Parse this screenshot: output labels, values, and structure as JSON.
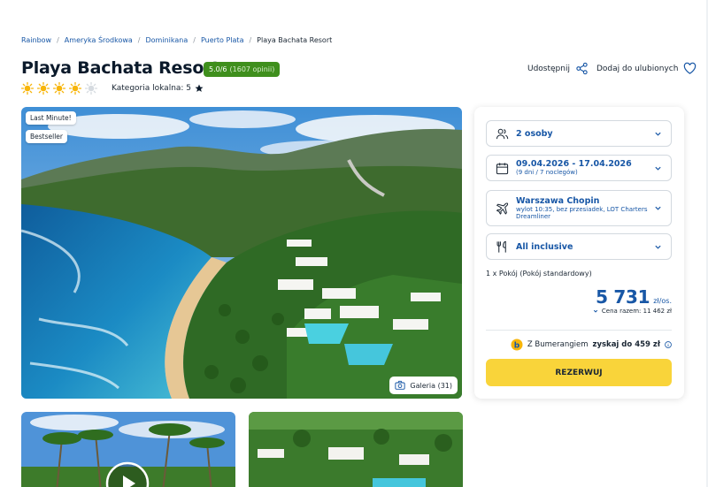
{
  "breadcrumb": [
    "Rainbow",
    "Ameryka Środkowa",
    "Dominikana",
    "Puerto Plata",
    "Playa Bachata Resort"
  ],
  "hotel": {
    "name": "Playa Bachata Resort",
    "rating": "5.0/6",
    "reviews": "(1607 opinii)",
    "stars_total": 5,
    "stars_filled": 4,
    "local_category": "Kategoria lokalna: 5"
  },
  "actions": {
    "share": "Udostępnij",
    "favorite": "Dodaj do ulubionych"
  },
  "hero": {
    "badges": [
      "Last Minute!",
      "Bestseller"
    ],
    "gallery": "Galeria (31)"
  },
  "booking": {
    "persons": "2 osoby",
    "dates": "09.04.2026 - 17.04.2026",
    "nights": "(9 dni / 7 noclegów)",
    "departure": "Warszawa Chopin",
    "flight": "wylot 10:35, bez przesiadek, LOT Charters Dreamliner",
    "board": "All inclusive",
    "room": "1 x Pokój   (Pokój standardowy)",
    "price": "5 731",
    "price_unit": "zł/os.",
    "total": "Cena razem: 11 462 zł",
    "bumerang_prefix": "Z Bumerangiem",
    "bumerang_bold": "zyskaj do 459 zł",
    "reserve": "REZERWUJ"
  },
  "colors": {
    "brand_blue": "#1857a6",
    "rating_green": "#3f8f1d",
    "cta_yellow": "#f9d43a",
    "sun_yellow": "#f7b50a"
  },
  "icons": [
    "share-icon",
    "heart-icon",
    "sun-icon",
    "star-icon",
    "camera-icon",
    "users-icon",
    "calendar-icon",
    "plane-icon",
    "cutlery-icon",
    "chevron-down-icon",
    "info-icon",
    "play-icon"
  ]
}
